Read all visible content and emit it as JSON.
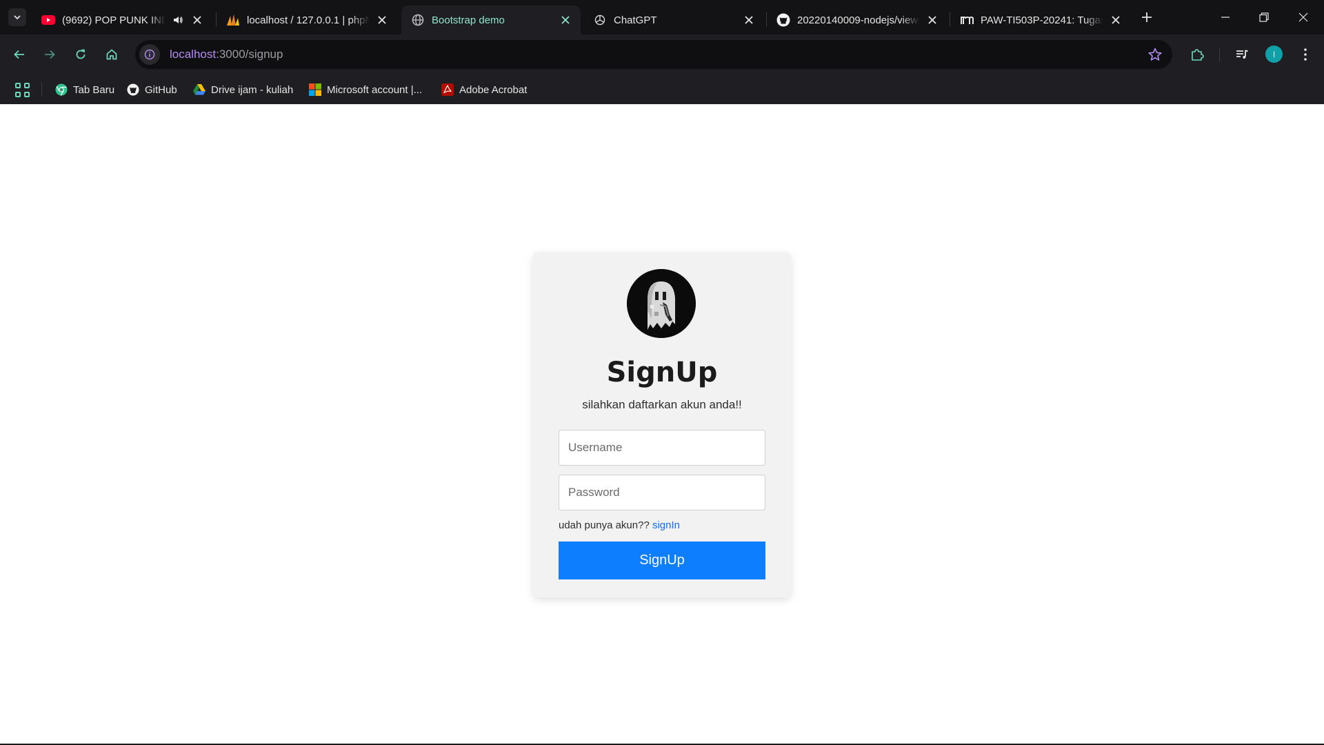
{
  "browser": {
    "tabs": [
      {
        "title": "(9692) POP PUNK INDONESIA",
        "icon": "youtube-icon",
        "audio": true,
        "active": false
      },
      {
        "title": "localhost / 127.0.0.1 | phpMyAdmin",
        "icon": "phpmyadmin-icon",
        "audio": false,
        "active": false
      },
      {
        "title": "Bootstrap demo",
        "icon": "globe-icon",
        "audio": false,
        "active": true
      },
      {
        "title": "ChatGPT",
        "icon": "chatgpt-icon",
        "audio": false,
        "active": false
      },
      {
        "title": "20220140009-nodejs/views",
        "icon": "github-icon",
        "audio": false,
        "active": false
      },
      {
        "title": "PAW-TI503P-20241: Tugas",
        "icon": "moodle-icon",
        "audio": false,
        "active": false
      }
    ],
    "address": {
      "host": "localhost",
      "path": ":3000/signup"
    },
    "profile_initial": "I",
    "bookmarks": [
      {
        "label": "Tab Baru",
        "icon": "chrome-icon"
      },
      {
        "label": "GitHub",
        "icon": "github-icon"
      },
      {
        "label": "Drive ijam - kuliah",
        "icon": "google-drive-icon"
      },
      {
        "label": "Microsoft account |...",
        "icon": "microsoft-icon"
      },
      {
        "label": "Adobe Acrobat",
        "icon": "acrobat-icon"
      }
    ],
    "colors": {
      "accent": "#8ee3c8",
      "host": "#b48cf2"
    }
  },
  "signup": {
    "title": "SignUp",
    "subtitle": "silahkan daftarkan akun anda!!",
    "username_placeholder": "Username",
    "password_placeholder": "Password",
    "hint_text": "udah punya akun?? ",
    "hint_link": "signIn",
    "submit_label": "SignUp",
    "colors": {
      "button": "#0d7efe",
      "link": "#0d6efd",
      "card": "#f2f2f2"
    }
  }
}
